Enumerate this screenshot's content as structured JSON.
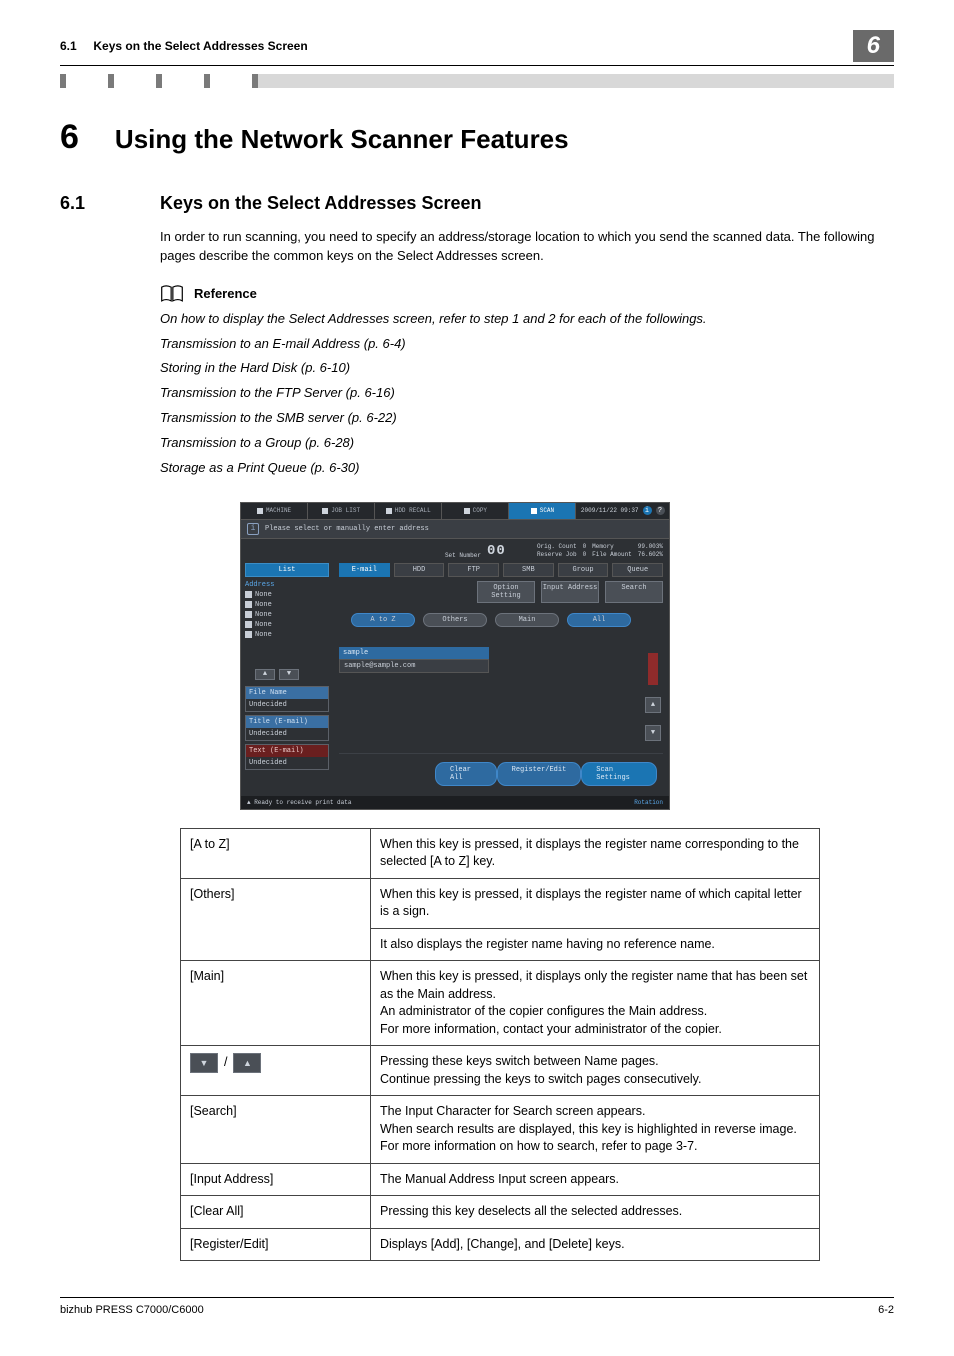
{
  "header": {
    "section_num_head": "6.1",
    "section_title_head": "Keys on the Select Addresses Screen",
    "chapter_tab": "6"
  },
  "chapter": {
    "num": "6",
    "title": "Using the Network Scanner Features"
  },
  "section": {
    "num": "6.1",
    "title": "Keys on the Select Addresses Screen"
  },
  "body_para": "In order to run scanning, you need to specify an address/storage location to which you send the scanned data. The following pages describe the common keys on the Select Addresses screen.",
  "reference": {
    "heading": "Reference",
    "intro": "On how to display the Select Addresses screen, refer to step 1 and 2 for each of the followings.",
    "items": [
      "Transmission to an E-mail Address (p. 6-4)",
      "Storing in the Hard Disk (p. 6-10)",
      "Transmission to the FTP Server (p. 6-16)",
      "Transmission to the SMB server (p. 6-22)",
      "Transmission to a Group (p. 6-28)",
      "Storage as a Print Queue (p. 6-30)"
    ]
  },
  "panel": {
    "tabs": [
      "MACHINE",
      "JOB LIST",
      "HDD RECALL",
      "COPY",
      "SCAN"
    ],
    "datetime": "2009/11/22 09:37",
    "prompt": "Please select or manually enter address",
    "set_number_label": "Set Number",
    "set_number_value": "00",
    "orig_count_label": "Orig. Count",
    "orig_count_value": "0",
    "reserve_job_label": "Reserve Job",
    "reserve_job_value": "0",
    "memory_label": "Memory",
    "memory_value": "99.003%",
    "file_amount_label": "File Amount",
    "file_amount_value": "76.602%",
    "side": {
      "list": "List",
      "address": "Address",
      "none": "None",
      "file_name": "File Name",
      "title": "Title (E-mail)",
      "text": "Text (E-mail)",
      "undecided": "Undecided"
    },
    "dest_tabs": [
      "E-mail",
      "HDD",
      "FTP",
      "SMB",
      "Group",
      "Queue"
    ],
    "action_btns": [
      "Option Setting",
      "Input Address",
      "Search"
    ],
    "filter_pills": [
      "A to Z",
      "Others",
      "Main",
      "All"
    ],
    "entry_name": "sample",
    "entry_sub": "sample@sample.com",
    "bottom_btns": [
      "Clear All",
      "Register/Edit",
      "Scan Settings"
    ],
    "status_left": "Ready to receive print data",
    "status_right": "Rotation"
  },
  "keys_table": [
    {
      "key": "[A to Z]",
      "desc": [
        "When this key is pressed, it displays the register name corresponding to the selected [A to Z] key."
      ]
    },
    {
      "key": "[Others]",
      "desc": [
        "When this key is pressed, it displays the register name of which capital letter is a sign.",
        "It also displays the register name having no reference name."
      ]
    },
    {
      "key": "[Main]",
      "desc": [
        "When this key is pressed, it displays only the register name that has been set as the Main address.\nAn administrator of the copier configures the Main address.\nFor more information, contact your administrator of the copier."
      ]
    },
    {
      "key": "__PAGER__",
      "desc": [
        "Pressing these keys switch between Name pages.\nContinue pressing the keys to switch pages consecutively."
      ]
    },
    {
      "key": "[Search]",
      "desc": [
        "The Input Character for Search screen appears.\nWhen search results are displayed, this key is highlighted in reverse image.\nFor more information on how to search, refer to page 3-7."
      ]
    },
    {
      "key": "[Input Address]",
      "desc": [
        "The Manual Address Input screen appears."
      ]
    },
    {
      "key": "[Clear All]",
      "desc": [
        "Pressing this key deselects all the selected addresses."
      ]
    },
    {
      "key": "[Register/Edit]",
      "desc": [
        "Displays [Add], [Change], and [Delete] keys."
      ]
    }
  ],
  "footer": {
    "left": "bizhub PRESS C7000/C6000",
    "right": "6-2"
  }
}
